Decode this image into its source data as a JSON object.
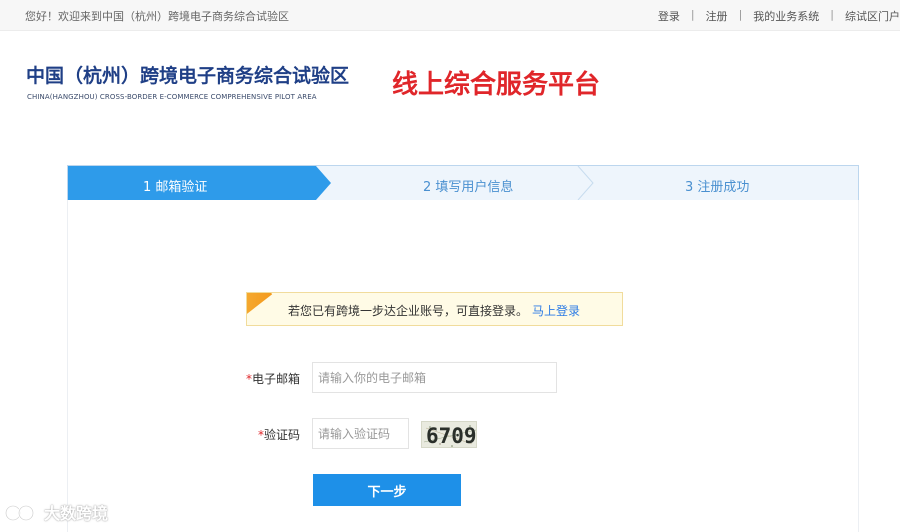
{
  "topbar": {
    "greeting": "您好！欢迎来到中国（杭州）跨境电子商务综合试验区",
    "links": [
      "登录",
      "注册",
      "我的业务系统",
      "综试区门户"
    ]
  },
  "header": {
    "logo_cn": "中国（杭州）跨境电子商务综合试验区",
    "logo_en": "CHINA(HANGZHOU) CROSS-BORDER E-COMMERCE COMPREHENSIVE PILOT AREA",
    "platform": "线上综合服务平台"
  },
  "steps": [
    {
      "label": "1 邮箱验证",
      "active": true
    },
    {
      "label": "2 填写用户信息",
      "active": false
    },
    {
      "label": "3 注册成功",
      "active": false
    }
  ],
  "notice": {
    "text": "若您已有跨境一步达企业账号，可直接登录。",
    "link": "马上登录"
  },
  "form": {
    "required_mark": "*",
    "email_label": "电子邮箱",
    "email_placeholder": "请输入你的电子邮箱",
    "email_value": "",
    "code_label": "验证码",
    "code_placeholder": "请输入验证码",
    "code_value": "",
    "captcha_text": "6709",
    "next_button": "下一步"
  },
  "watermark": {
    "text": "大数跨境"
  },
  "colors": {
    "accent": "#1e90e8",
    "step_active": "#2e9bea",
    "logo": "#1f3f86",
    "platform": "#e0262a",
    "link": "#2c7be5"
  }
}
